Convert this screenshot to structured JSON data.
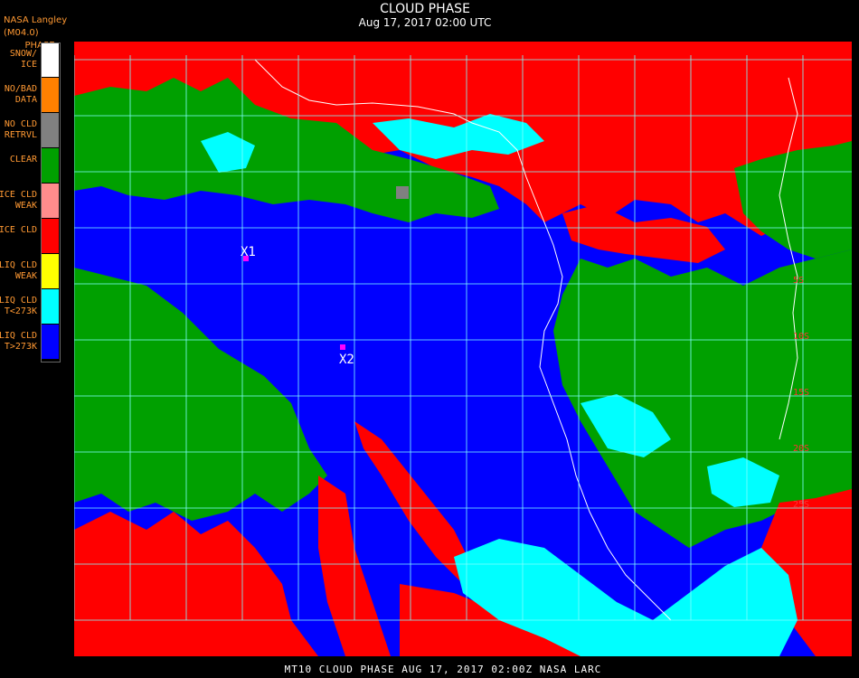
{
  "header": {
    "organization": "NASA Langley (M04.0)",
    "product": "PHASE"
  },
  "title": {
    "main": "CLOUD PHASE",
    "subtitle": "Aug 17, 2017 02:00 UTC"
  },
  "legend": {
    "items": [
      {
        "label": "SNOW/\nICE",
        "color": "#ffffff"
      },
      {
        "label": "NO/BAD\nDATA",
        "color": "#ff8000"
      },
      {
        "label": "NO CLD\nRETRVL",
        "color": "#808080"
      },
      {
        "label": "CLEAR",
        "color": "#00a000"
      },
      {
        "label": "ICE CLD\nWEAK",
        "color": "#ff8c8c"
      },
      {
        "label": "ICE CLD",
        "color": "#ff0000"
      },
      {
        "label": "LIQ CLD\nWEAK",
        "color": "#ffff00"
      },
      {
        "label": "LIQ CLD\nT<273K",
        "color": "#00ffff"
      },
      {
        "label": "LIQ CLD\nT>273K",
        "color": "#0000ff"
      }
    ]
  },
  "markers": [
    {
      "label": "X1",
      "color": "#ff00ff"
    },
    {
      "label": "X2",
      "color": "#ff00ff"
    }
  ],
  "grid_labels": [
    "5S",
    "10S",
    "15S",
    "20S",
    "25S"
  ],
  "colors": {
    "background": "#000000",
    "grid": "#80ffff",
    "coastline": "#ffffff",
    "ice": "#ff0000",
    "clear": "#00a000",
    "liquid_warm": "#0000ff",
    "liquid_cold": "#00ffff"
  },
  "footer": "MT10  CLOUD PHASE   AUG 17, 2017 02:00Z  NASA LARC"
}
